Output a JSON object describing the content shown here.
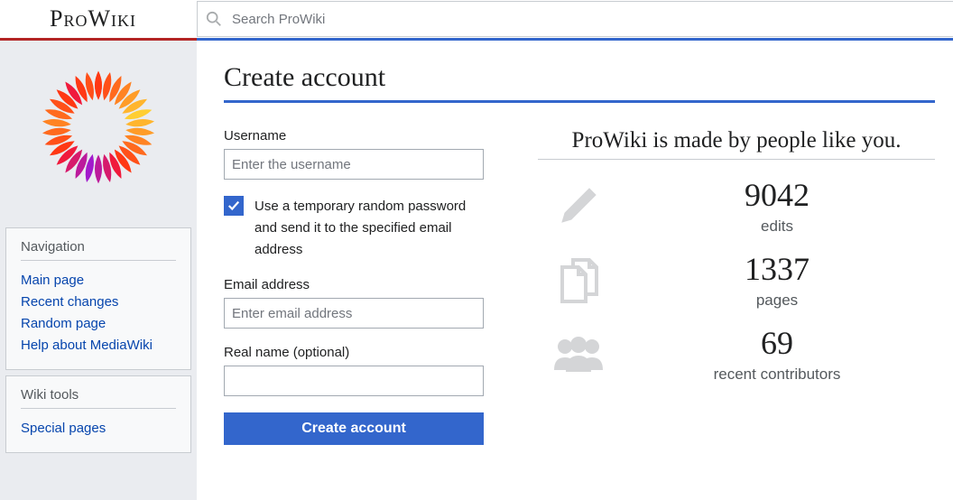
{
  "site": {
    "name": "ProWiki"
  },
  "search": {
    "placeholder": "Search ProWiki"
  },
  "nav": {
    "title": "Navigation",
    "items": [
      "Main page",
      "Recent changes",
      "Random page",
      "Help about MediaWiki"
    ]
  },
  "tools": {
    "title": "Wiki tools",
    "items": [
      "Special pages"
    ]
  },
  "page": {
    "title": "Create account"
  },
  "form": {
    "username_label": "Username",
    "username_placeholder": "Enter the username",
    "temp_pw": "Use a temporary random password and send it to the specified email address",
    "email_label": "Email address",
    "email_placeholder": "Enter email address",
    "realname_label": "Real name (optional)",
    "submit": "Create account"
  },
  "stats": {
    "title": "ProWiki is made by people like you.",
    "edits_num": "9042",
    "edits_label": "edits",
    "pages_num": "1337",
    "pages_label": "pages",
    "contrib_num": "69",
    "contrib_label": "recent contributors"
  }
}
